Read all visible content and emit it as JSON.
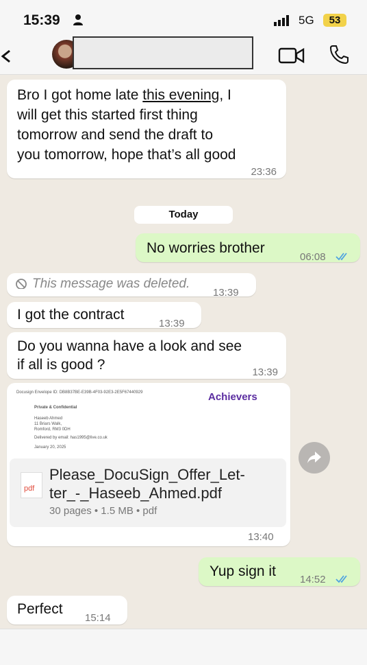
{
  "status": {
    "time": "15:39",
    "network": "5G",
    "battery": "53"
  },
  "header": {
    "contact_name": ""
  },
  "messages": {
    "m1_line1": "Bro I got home late ",
    "m1_link": "this evening",
    "m1_line1_end": ", I",
    "m1_line2": "will get this started first thing",
    "m1_line3": "tomorrow and send the draft to",
    "m1_line4": "you tomorrow, hope that’s all good",
    "m1_time": "23:36",
    "day": "Today",
    "m2": "No worries brother",
    "m2_time": "06:08",
    "m3": "This message was deleted.",
    "m3_time": "13:39",
    "m4": "I got the contract",
    "m4_time": "13:39",
    "m5_line1": "Do you wanna have a look and see",
    "m5_line2": "if all is good ?",
    "m5_time": "13:39",
    "doc": {
      "preview_envelope": "Docusign Envelope ID: DB8B37BE-E39B-4F03-92E3-2E5F67440929",
      "brand": "Achievers",
      "preview_heading": "Private & Confidential",
      "preview_name": "Haseeb Ahmed",
      "preview_addr1": "11 Briars Walk,",
      "preview_addr2": "Romford, RM3 0DH",
      "preview_delivered": "Delivered by email: has1995@live.co.uk",
      "preview_date": "January 20, 2025",
      "icon_label": "pdf",
      "filename_line1": "Please_DocuSign_Offer_Let-",
      "filename_line2": "ter_-_Haseeb_Ahmed.pdf",
      "meta": "30 pages • 1.5 MB • pdf",
      "time": "13:40"
    },
    "m6": "Yup sign it",
    "m6_time": "14:52",
    "m7": "Perfect",
    "m7_time": "15:14"
  },
  "colors": {
    "incoming": "#ffffff",
    "outgoing": "#dcf8c6",
    "tick": "#4fa3e0"
  }
}
